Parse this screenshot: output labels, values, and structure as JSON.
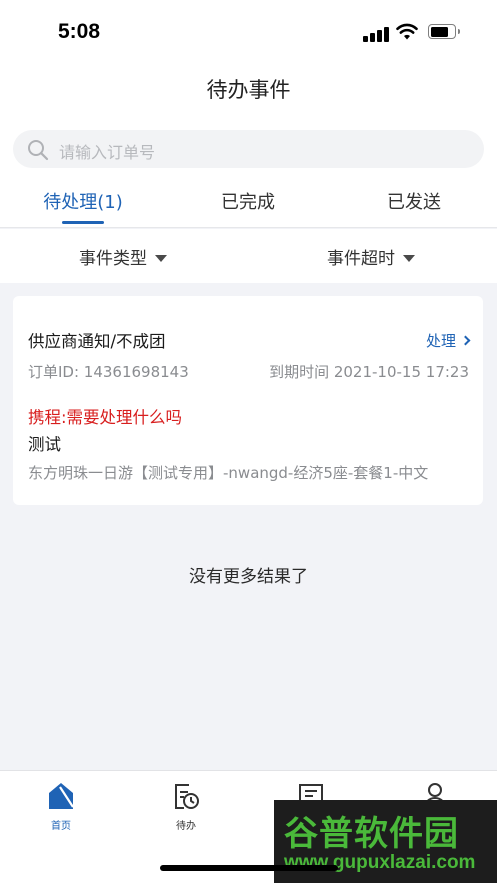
{
  "status_bar": {
    "time": "5:08"
  },
  "nav": {
    "title": "待办事件"
  },
  "search": {
    "placeholder": "请输入订单号",
    "icon": "search-icon"
  },
  "tabs": [
    {
      "label": "待处理(1)",
      "active": true
    },
    {
      "label": "已完成",
      "active": false
    },
    {
      "label": "已发送",
      "active": false
    }
  ],
  "filters": [
    {
      "label": "事件类型"
    },
    {
      "label": "事件超时"
    }
  ],
  "card": {
    "title": "供应商通知/不成团",
    "action": "处理",
    "order_id": "订单ID: 14361698143",
    "due_time": "到期时间 2021-10-15 17:23",
    "alert": "携程:需要处理什么吗",
    "note": "测试",
    "product": "东方明珠一日游【测试专用】-nwangd-经济5座-套餐1-中文"
  },
  "no_more": "没有更多结果了",
  "tabbar": [
    {
      "label": "首页",
      "icon": "home-icon",
      "active": true
    },
    {
      "label": "待办",
      "icon": "todo-clock-icon",
      "active": false
    },
    {
      "label": "",
      "icon": "message-icon",
      "active": false
    },
    {
      "label": "",
      "icon": "user-icon",
      "active": false
    }
  ],
  "watermark": {
    "title": "谷普软件园",
    "url": "www.gupuxlazai.com"
  },
  "colors": {
    "accent": "#1f63b5",
    "alert": "#d81e1e",
    "watermark": "#4ab93a"
  }
}
